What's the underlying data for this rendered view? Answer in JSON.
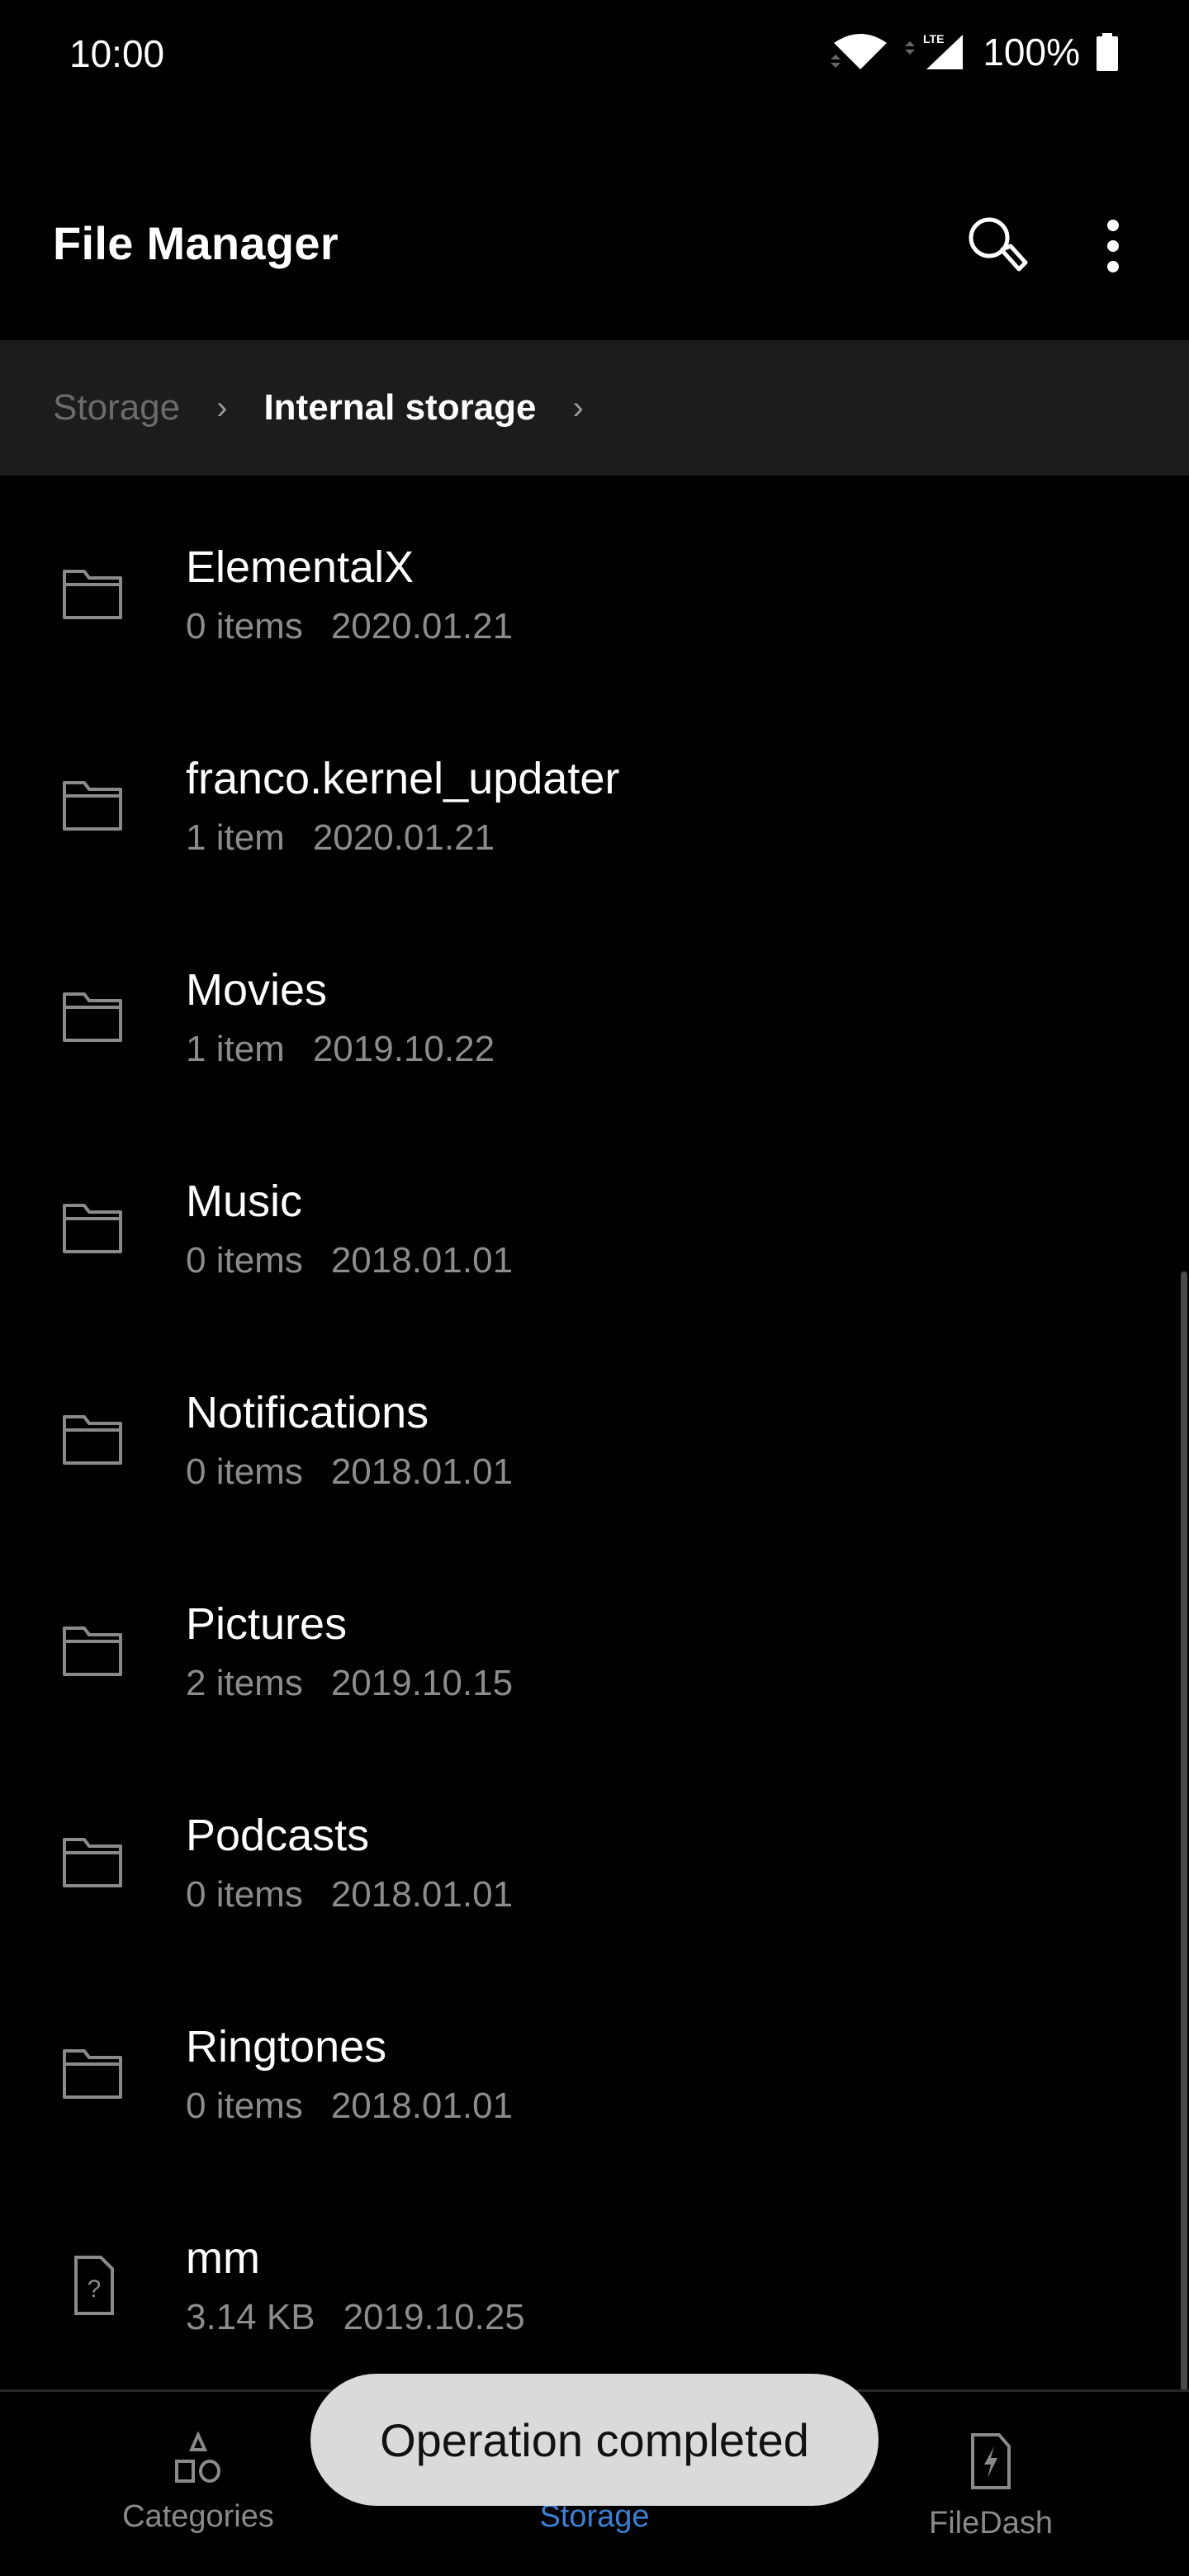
{
  "status_bar": {
    "time": "10:00",
    "battery": "100%",
    "network_label": "LTE",
    "icons": [
      "wifi-icon",
      "lte-signal-icon",
      "battery-icon"
    ]
  },
  "app_bar": {
    "title": "File Manager",
    "icons": [
      "search-icon",
      "more-vert-icon"
    ]
  },
  "breadcrumb": {
    "items": [
      "Storage",
      "Internal storage"
    ]
  },
  "files": [
    {
      "name": "ElementalX",
      "count": "0 items",
      "date": "2020.01.21",
      "icon": "folder-icon"
    },
    {
      "name": "franco.kernel_updater",
      "count": "1 item",
      "date": "2020.01.21",
      "icon": "folder-icon"
    },
    {
      "name": "Movies",
      "count": "1 item",
      "date": "2019.10.22",
      "icon": "folder-icon"
    },
    {
      "name": "Music",
      "count": "0 items",
      "date": "2018.01.01",
      "icon": "folder-icon"
    },
    {
      "name": "Notifications",
      "count": "0 items",
      "date": "2018.01.01",
      "icon": "folder-icon"
    },
    {
      "name": "Pictures",
      "count": "2 items",
      "date": "2019.10.15",
      "icon": "folder-icon"
    },
    {
      "name": "Podcasts",
      "count": "0 items",
      "date": "2018.01.01",
      "icon": "folder-icon"
    },
    {
      "name": "Ringtones",
      "count": "0 items",
      "date": "2018.01.01",
      "icon": "folder-icon"
    },
    {
      "name": "mm",
      "count": "3.14 KB",
      "date": "2019.10.25",
      "icon": "unknown-file-icon"
    }
  ],
  "bottom_nav": {
    "items": [
      {
        "label": "Categories",
        "icon": "categories-icon"
      },
      {
        "label": "Storage",
        "icon": "storage-icon",
        "active": true
      },
      {
        "label": "FileDash",
        "icon": "filedash-icon"
      }
    ]
  },
  "toast": {
    "message": "Operation completed"
  },
  "colors": {
    "accent": "#3d7fd1",
    "background": "#000000",
    "breadcrumb_bg": "#1c1c1c",
    "toast_bg": "#dadada"
  }
}
